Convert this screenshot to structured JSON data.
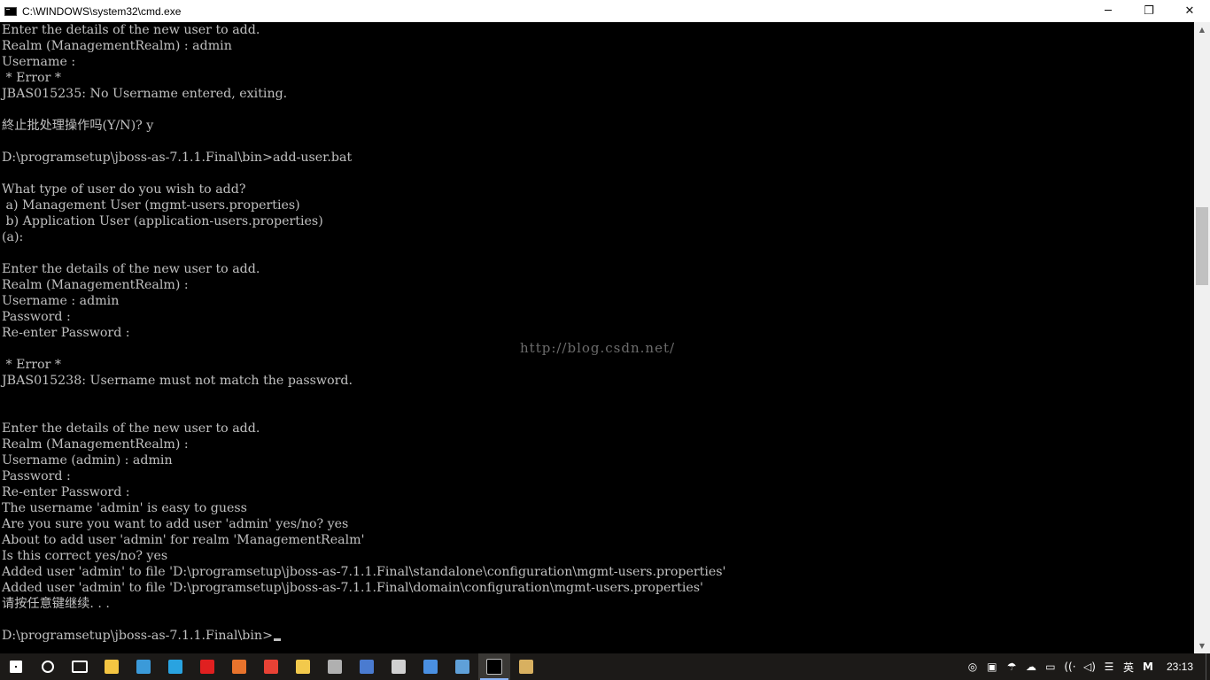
{
  "window": {
    "title": "C:\\WINDOWS\\system32\\cmd.exe",
    "minimize": "─",
    "maximize": "❐",
    "close": "✕"
  },
  "console": {
    "lines": [
      "Enter the details of the new user to add.",
      "Realm (ManagementRealm) : admin",
      "Username :",
      " * Error *",
      "JBAS015235: No Username entered, exiting.",
      "",
      "終止批处理操作吗(Y/N)? y",
      "",
      "D:\\programsetup\\jboss-as-7.1.1.Final\\bin>add-user.bat",
      "",
      "What type of user do you wish to add?",
      " a) Management User (mgmt-users.properties)",
      " b) Application User (application-users.properties)",
      "(a):",
      "",
      "Enter the details of the new user to add.",
      "Realm (ManagementRealm) :",
      "Username : admin",
      "Password :",
      "Re-enter Password :",
      "",
      " * Error *",
      "JBAS015238: Username must not match the password.",
      "",
      "",
      "Enter the details of the new user to add.",
      "Realm (ManagementRealm) :",
      "Username (admin) : admin",
      "Password :",
      "Re-enter Password :",
      "The username 'admin' is easy to guess",
      "Are you sure you want to add user 'admin' yes/no? yes",
      "About to add user 'admin' for realm 'ManagementRealm'",
      "Is this correct yes/no? yes",
      "Added user 'admin' to file 'D:\\programsetup\\jboss-as-7.1.1.Final\\standalone\\configuration\\mgmt-users.properties'",
      "Added user 'admin' to file 'D:\\programsetup\\jboss-as-7.1.1.Final\\domain\\configuration\\mgmt-users.properties'",
      "请按任意键继续. . .",
      "",
      "D:\\programsetup\\jboss-as-7.1.1.Final\\bin>"
    ],
    "watermark": "http://blog.csdn.net/"
  },
  "scrollbar": {
    "up_arrow": "▲",
    "down_arrow": "▼"
  },
  "taskbar": {
    "items": [
      {
        "name": "start-button-icon",
        "color": "#ffffff",
        "interactable": true
      },
      {
        "name": "search-icon",
        "color": "#ffffff",
        "interactable": true
      },
      {
        "name": "task-view-icon",
        "color": "#ffffff",
        "interactable": true
      },
      {
        "name": "file-explorer-icon",
        "color": "#f4c542",
        "interactable": true
      },
      {
        "name": "app-icon-1",
        "color": "#3b9ad9",
        "interactable": true
      },
      {
        "name": "app-icon-2",
        "color": "#29a3e0",
        "interactable": true
      },
      {
        "name": "app-icon-le",
        "color": "#e02020",
        "interactable": true
      },
      {
        "name": "pdf-app-icon",
        "color": "#e8732c",
        "interactable": true
      },
      {
        "name": "chrome-icon",
        "color": "#e94235",
        "interactable": true
      },
      {
        "name": "app-icon-3",
        "color": "#f2c94c",
        "interactable": true
      },
      {
        "name": "settings-app-icon",
        "color": "#b0b0b0",
        "interactable": true
      },
      {
        "name": "app-icon-4",
        "color": "#4a7bd0",
        "interactable": true
      },
      {
        "name": "app-icon-5",
        "color": "#d0d0d0",
        "interactable": true
      },
      {
        "name": "app-icon-6",
        "color": "#4a90e2",
        "interactable": true
      },
      {
        "name": "app-icon-7",
        "color": "#5fa0d8",
        "interactable": true
      },
      {
        "name": "cmd-app-icon",
        "color": "#000000",
        "interactable": true,
        "active": true
      },
      {
        "name": "app-icon-8",
        "color": "#d8b060",
        "interactable": true
      }
    ],
    "tray": {
      "icons": [
        "◎",
        "▣",
        "☂",
        "☁",
        "▭",
        "((·",
        "◁)",
        "☰"
      ],
      "ime": "英",
      "ime_mode": "M",
      "time": "23:13"
    }
  }
}
